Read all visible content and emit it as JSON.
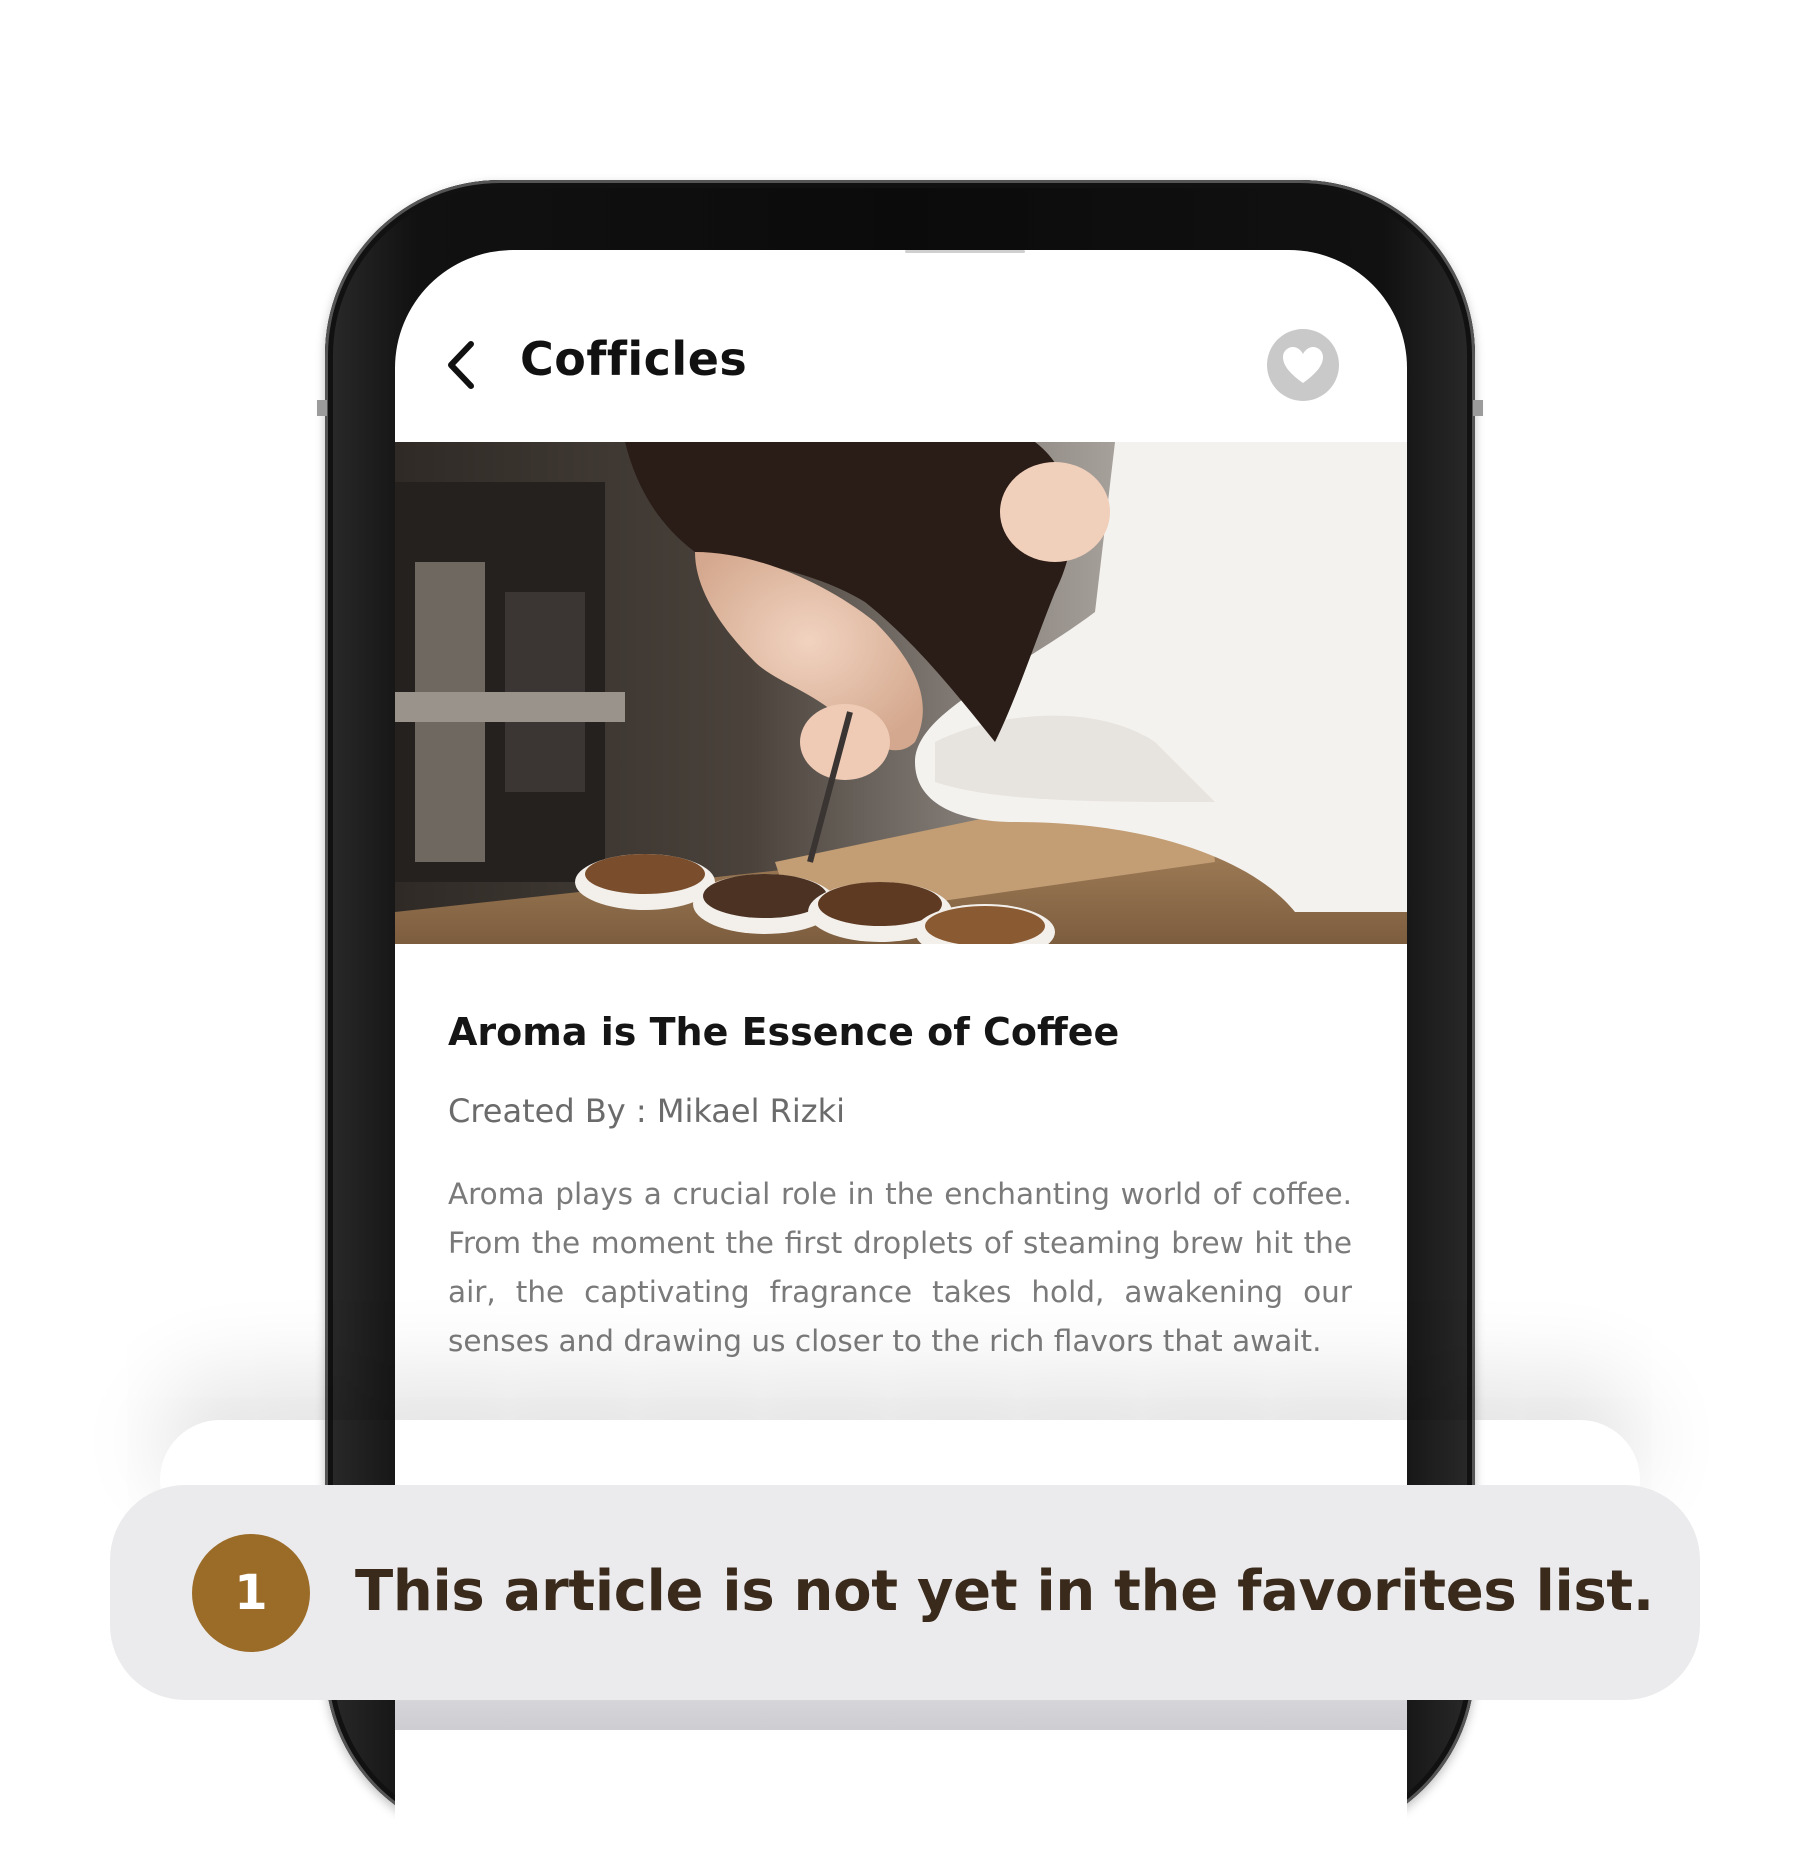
{
  "app": {
    "title": "Cofficles"
  },
  "icons": {
    "back": "chevron-left-icon",
    "favorite": "heart-icon"
  },
  "hero_image": {
    "description_name": "barista-smelling-coffee-photo"
  },
  "article": {
    "title": "Aroma is The Essence of Coffee",
    "author": "Created By : Mikael Rizki",
    "body": "Aroma plays a crucial role in the enchanting world of coffee. From the moment the first droplets of steaming brew hit the air, the captivating fragrance takes hold, awakening our senses and drawing us closer to the rich flavors that await."
  },
  "caption": {
    "step": "1",
    "text": "This article is not yet in the favorites list."
  },
  "colors": {
    "accent": "#9b6b28",
    "favorite_inactive": "#c9c9c9",
    "caption_bg": "#ebebed"
  }
}
